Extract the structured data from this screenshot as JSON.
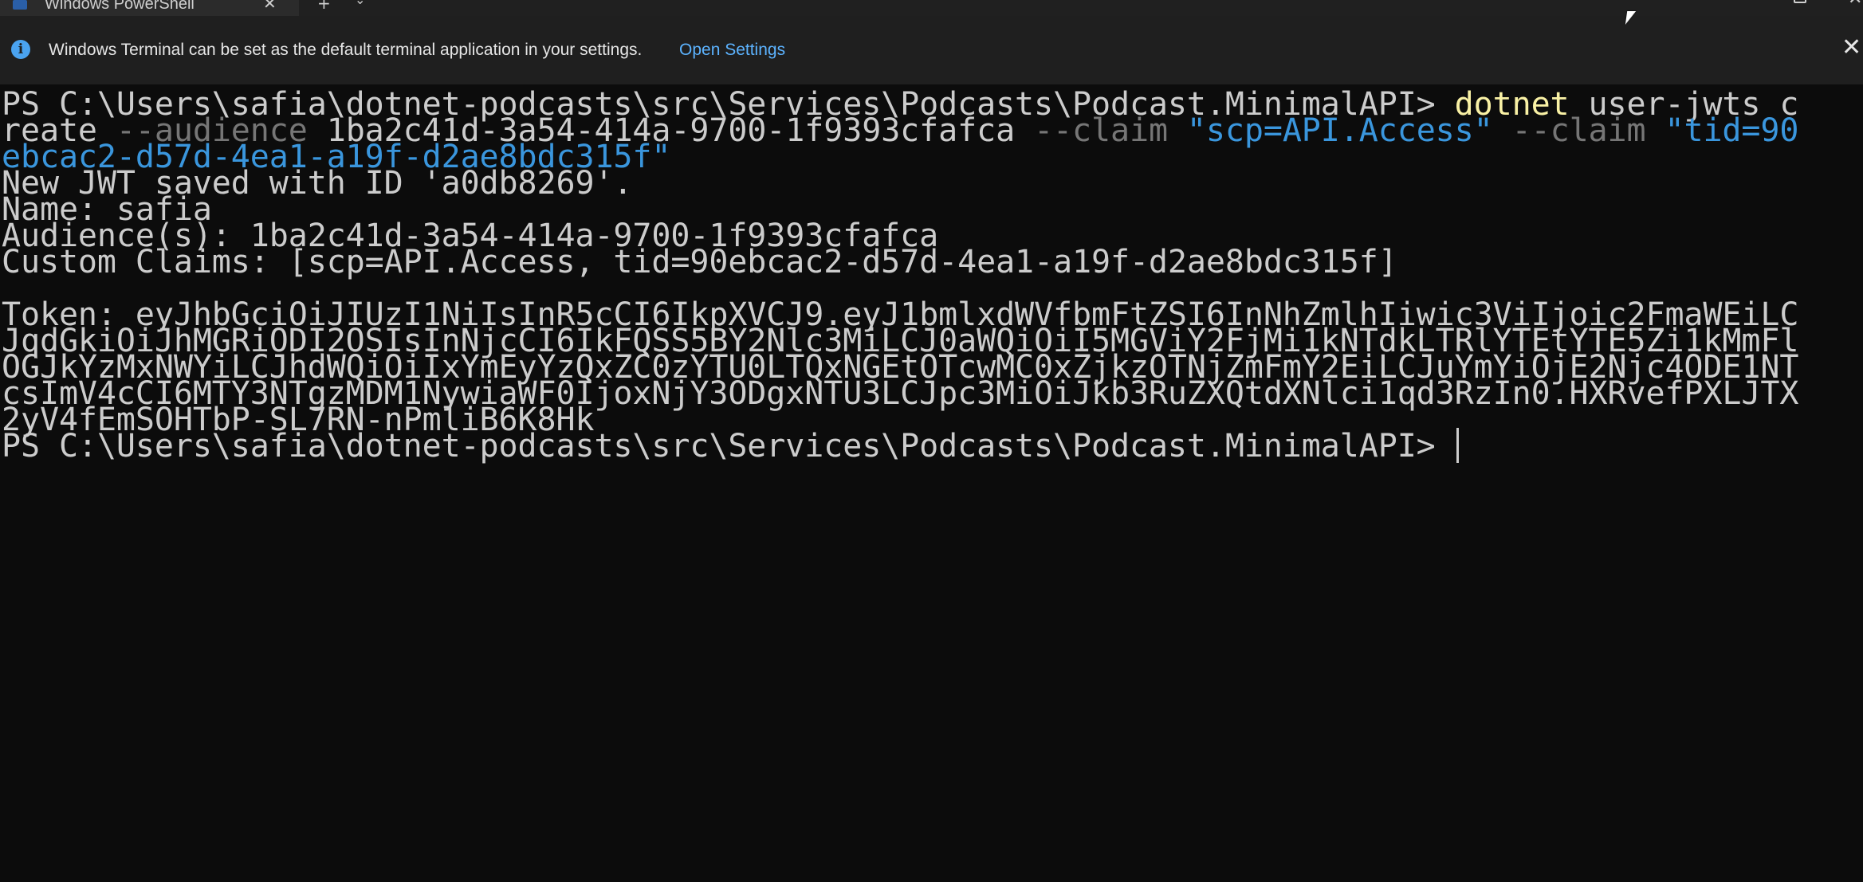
{
  "window": {
    "tab_title": "Windows PowerShell",
    "tab_close": "✕",
    "new_tab": "+",
    "tab_dropdown": "⌄",
    "close": "✕"
  },
  "infobar": {
    "icon": "i",
    "message": "Windows Terminal can be set as the default terminal application in your settings.",
    "link_label": "Open Settings",
    "close": "✕"
  },
  "terminal": {
    "prompt": "PS C:\\Users\\safia\\dotnet-podcasts\\src\\Services\\Podcasts\\Podcast.MinimalAPI> ",
    "command": {
      "cmd": "dotnet",
      "args1": " user-jwts c",
      "args1b": "reate ",
      "param_audience": "--audience",
      "audience_value": " 1ba2c41d-3a54-414a-9700-1f9393cfafca ",
      "param_claim1": "--claim",
      "claim1_value": " \"scp=API.Access\" ",
      "param_claim2": "--claim",
      "claim2_value_a": " \"tid=90",
      "claim2_value_b": "ebcac2-d57d-4ea1-a19f-d2ae8bdc315f\""
    },
    "output": [
      "New JWT saved with ID 'a0db8269'.",
      "Name: safia",
      "Audience(s): 1ba2c41d-3a54-414a-9700-1f9393cfafca",
      "Custom Claims: [scp=API.Access, tid=90ebcac2-d57d-4ea1-a19f-d2ae8bdc315f]",
      "",
      "Token: eyJhbGciOiJIUzI1NiIsInR5cCI6IkpXVCJ9.eyJ1bmlxdWVfbmFtZSI6InNhZmlhIiwic3ViIjoic2FmaWEiLC",
      "JqdGkiOiJhMGRiODI2OSIsInNjcCI6IkFQSS5BY2Nlc3MiLCJ0aWQiOiI5MGViY2FjMi1kNTdkLTRlYTEtYTE5Zi1kMmFl",
      "OGJkYzMxNWYiLCJhdWQiOiIxYmEyYzQxZC0zYTU0LTQxNGEtOTcwMC0xZjkzOTNjZmFmY2EiLCJuYmYiOjE2Njc4ODE1NT",
      "csImV4cCI6MTY3NTgzMDM1NywiaWF0IjoxNjY3ODgxNTU3LCJpc3MiOiJkb3RuZXQtdXNlci1qd3RzIn0.HXRvefPXLJTX",
      "2yV4fEmSOHTbP-SL7RN-nPmliB6K8Hk"
    ],
    "final_prompt": "PS C:\\Users\\safia\\dotnet-podcasts\\src\\Services\\Podcasts\\Podcast.MinimalAPI> "
  },
  "colors": {
    "background": "#0c0c0c",
    "foreground": "#cccccc",
    "command": "#f9f1a5",
    "parameter": "#767676",
    "string": "#3a96dd",
    "link": "#5cb3ff"
  }
}
